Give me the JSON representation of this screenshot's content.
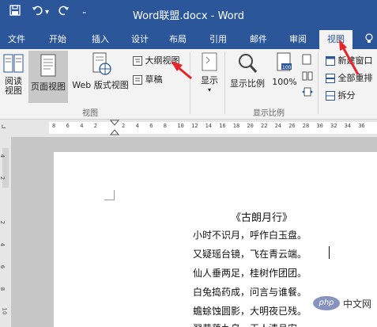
{
  "title_bar": {
    "save_icon": "save-icon",
    "undo_icon": "undo-icon",
    "redo_icon": "redo-icon",
    "customize_icon": "customize-icon",
    "title": "Word联盟.docx - Word"
  },
  "tabs": [
    "文件",
    "开始",
    "插入",
    "设计",
    "布局",
    "引用",
    "邮件",
    "审阅",
    "视图"
  ],
  "ribbon": {
    "views": {
      "read_mode": [
        "阅读",
        "视图"
      ],
      "print_layout": "页面视图",
      "web_layout": "Web 版式视图",
      "outline": "大纲视图",
      "draft": "草稿",
      "group": "视图"
    },
    "show": "显示",
    "zoom": {
      "zoom": "显示比例",
      "percent": "100%",
      "group": "显示比例"
    },
    "window": {
      "new_window": "新建窗口",
      "arrange_all": "全部重排",
      "split": "拆分"
    }
  },
  "ruler_ticks": [
    "8",
    "6",
    "4",
    "2",
    "",
    "2",
    "4",
    "6",
    "8",
    "10",
    "12",
    "14",
    "16",
    "18",
    "20",
    "22",
    "24",
    "26",
    "28",
    "30",
    "32",
    "34",
    "36"
  ],
  "vruler_ticks": [
    "4",
    "2",
    "",
    "2",
    "4",
    "6",
    "8",
    "10"
  ],
  "document": {
    "title": "《古朗月行》",
    "lines": [
      "小时不识月，呼作白玉盘。",
      "又疑瑶台镜，飞在青云端。",
      "仙人垂两足，桂树作团团。",
      "白兔捣药成，问言与谁餐。",
      "蟾蜍蚀圆影，大明夜已残。",
      "羿昔落九乌，天人清且安。"
    ]
  },
  "watermark": {
    "logo": "php",
    "text": "中文网"
  },
  "colors": {
    "accent": "#2b579a",
    "arrow": "#e8242a"
  }
}
